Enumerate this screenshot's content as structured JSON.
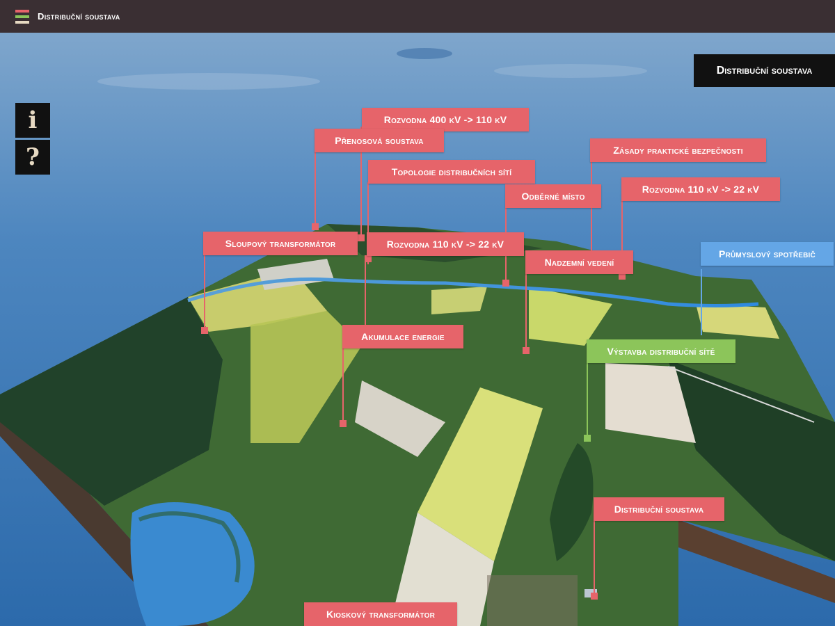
{
  "app": {
    "title": "Distribuční soustava"
  },
  "colors": {
    "topbar": "#3a2f33",
    "hotspot_red": "#e6646a",
    "hotspot_blue": "#64a6e6",
    "hotspot_green": "#8cc55a",
    "sky": "#4d86bf",
    "terrain": "#3f6a34"
  },
  "side_buttons": {
    "info": {
      "glyph": "i",
      "icon": "info-icon"
    },
    "help": {
      "glyph": "?",
      "icon": "question-icon"
    }
  },
  "scene_title": "Distribuční soustava",
  "hotspots": {
    "rozvodna_400": "Rozvodna 400 kV -> 110 kV",
    "prenosova": "Přenosová soustava",
    "zasady": "Zásady praktické bezpečnosti",
    "topologie": "Topologie distribučních sítí",
    "odberne": "Odběrné místo",
    "rozvodna_110_right": "Rozvodna 110 kV -> 22 kV",
    "sloupovy": "Sloupový transformátor",
    "rozvodna_110_center": "Rozvodna 110 kV -> 22 kV",
    "prumyslovy": "Průmyslový spotřebič",
    "nadzemni": "Nadzemní vedení",
    "akumulace": "Akumulace energie",
    "vystavba": "Výstavba distribuční sítě",
    "distribucni": "Distribuční soustava",
    "kioskovy": "Kioskový transformátor"
  }
}
